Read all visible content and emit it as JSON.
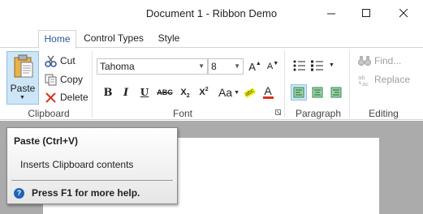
{
  "window": {
    "title": "Document 1 - Ribbon Demo"
  },
  "tabs": [
    {
      "label": "Home",
      "active": true
    },
    {
      "label": "Control Types",
      "active": false
    },
    {
      "label": "Style",
      "active": false
    }
  ],
  "clipboard": {
    "group_label": "Clipboard",
    "paste_label": "Paste",
    "cut_label": "Cut",
    "copy_label": "Copy",
    "delete_label": "Delete"
  },
  "font": {
    "group_label": "Font",
    "family_value": "Tahoma",
    "size_value": "8",
    "bold": "B",
    "italic": "I",
    "underline": "U",
    "strike": "ABC",
    "subscript": "X",
    "subscript_mark": "2",
    "superscript": "X",
    "superscript_mark": "2",
    "change_case": "Aa",
    "highlight_text": "abc",
    "font_color_text": "A",
    "grow_glyph": "A",
    "shrink_glyph": "A"
  },
  "paragraph": {
    "group_label": "Paragraph"
  },
  "editing": {
    "group_label": "Editing",
    "find_label": "Find...",
    "replace_label": "Replace"
  },
  "tooltip": {
    "title": "Paste (Ctrl+V)",
    "description": "Inserts Clipboard contents",
    "help": "Press F1 for more help."
  },
  "colors": {
    "accent": "#2b579a",
    "active_fill": "#cde6f7",
    "active_border": "#92c0e0",
    "document_background": "#ababab"
  }
}
